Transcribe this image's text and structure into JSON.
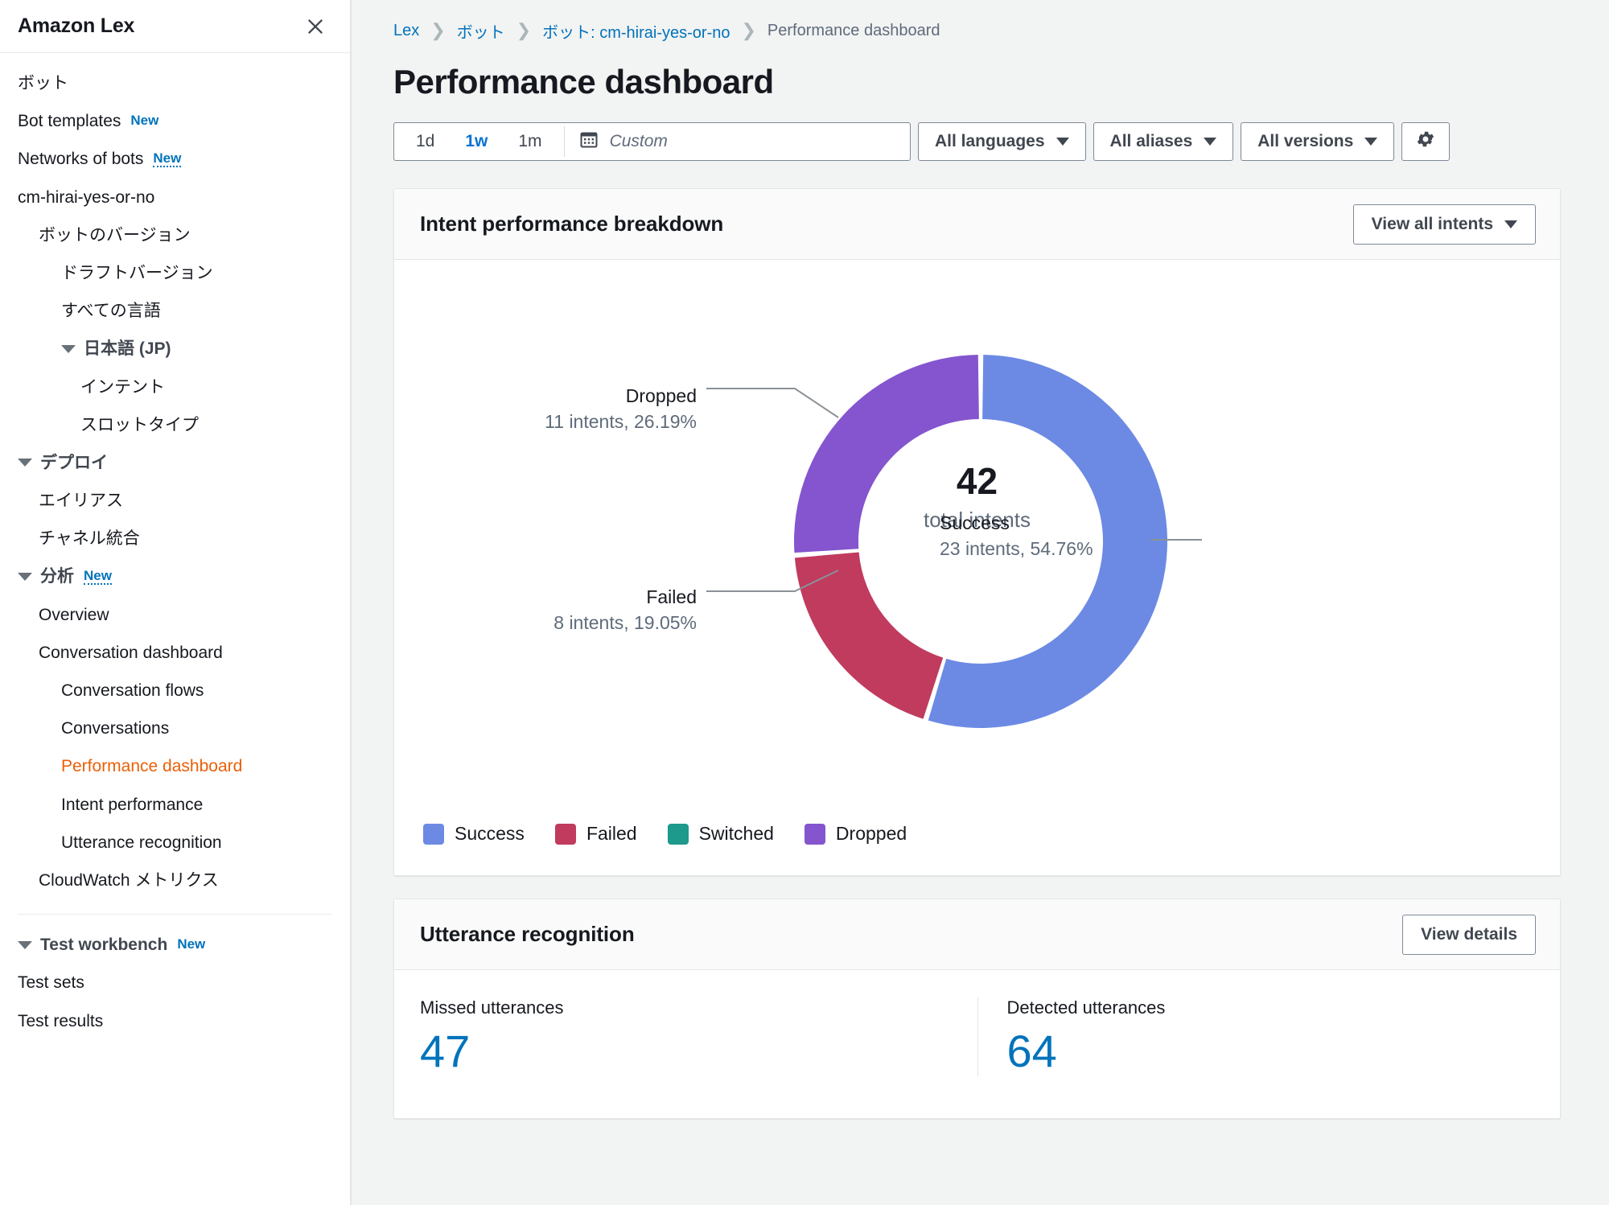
{
  "sidebar": {
    "title": "Amazon Lex",
    "close_icon": "close-icon",
    "items": [
      {
        "label": "ボット",
        "indent": 0,
        "type": "link"
      },
      {
        "label": "Bot templates",
        "indent": 0,
        "type": "link",
        "badge": "New",
        "badge_dotted": false
      },
      {
        "label": "Networks of bots",
        "indent": 0,
        "type": "link",
        "badge": "New",
        "badge_dotted": true
      },
      {
        "label": "cm-hirai-yes-or-no",
        "indent": 0,
        "type": "link"
      },
      {
        "label": "ボットのバージョン",
        "indent": 1,
        "type": "link"
      },
      {
        "label": "ドラフトバージョン",
        "indent": 2,
        "type": "link"
      },
      {
        "label": "すべての言語",
        "indent": 2,
        "type": "link"
      },
      {
        "label": "日本語 (JP)",
        "indent": 2,
        "type": "section",
        "caret": true
      },
      {
        "label": "インテント",
        "indent": 3,
        "type": "link"
      },
      {
        "label": "スロットタイプ",
        "indent": 3,
        "type": "link"
      },
      {
        "label": "デプロイ",
        "indent": 0,
        "type": "section",
        "caret": true
      },
      {
        "label": "エイリアス",
        "indent": 1,
        "type": "link"
      },
      {
        "label": "チャネル統合",
        "indent": 1,
        "type": "link"
      },
      {
        "label": "分析",
        "indent": 0,
        "type": "section",
        "caret": true,
        "badge": "New",
        "badge_dotted": true
      },
      {
        "label": "Overview",
        "indent": 1,
        "type": "link"
      },
      {
        "label": "Conversation dashboard",
        "indent": 1,
        "type": "link"
      },
      {
        "label": "Conversation flows",
        "indent": 2,
        "type": "link"
      },
      {
        "label": "Conversations",
        "indent": 2,
        "type": "link"
      },
      {
        "label": "Performance dashboard",
        "indent": 2,
        "type": "link",
        "active": true
      },
      {
        "label": "Intent performance",
        "indent": 2,
        "type": "link"
      },
      {
        "label": "Utterance recognition",
        "indent": 2,
        "type": "link"
      },
      {
        "label": "CloudWatch メトリクス",
        "indent": 1,
        "type": "link"
      },
      {
        "label": "Test workbench",
        "indent": 0,
        "type": "section",
        "caret": true,
        "badge": "New",
        "badge_dotted": false,
        "divider_before": true
      },
      {
        "label": "Test sets",
        "indent": 0,
        "type": "link"
      },
      {
        "label": "Test results",
        "indent": 0,
        "type": "link"
      }
    ]
  },
  "breadcrumb": {
    "items": [
      "Lex",
      "ボット",
      "ボット: cm-hirai-yes-or-no",
      "Performance dashboard"
    ],
    "separator": "❯"
  },
  "page": {
    "title": "Performance dashboard"
  },
  "toolbar": {
    "ranges": [
      {
        "label": "1d",
        "selected": false
      },
      {
        "label": "1w",
        "selected": true
      },
      {
        "label": "1m",
        "selected": false
      }
    ],
    "custom_placeholder": "Custom",
    "calendar_icon": "calendar-icon",
    "languages_label": "All languages",
    "aliases_label": "All aliases",
    "versions_label": "All versions",
    "settings_icon": "gear-icon"
  },
  "intent_card": {
    "title": "Intent performance breakdown",
    "view_all_label": "View all intents"
  },
  "chart_data": {
    "type": "pie",
    "title": "Intent performance breakdown",
    "center_value": "42",
    "center_label": "total intents",
    "total_intents": 42,
    "categories": [
      "Success",
      "Failed",
      "Switched",
      "Dropped"
    ],
    "values": [
      23,
      8,
      0,
      11
    ],
    "percents": [
      54.76,
      19.05,
      0,
      26.19
    ],
    "colors": [
      "#6C8AE4",
      "#C03B5E",
      "#1D9A8B",
      "#8455CE"
    ],
    "legend": [
      "Success",
      "Failed",
      "Switched",
      "Dropped"
    ],
    "legend_position": "bottom-left",
    "callouts": [
      {
        "name": "Success",
        "detail": "23 intents, 54.76%"
      },
      {
        "name": "Failed",
        "detail": "8 intents, 19.05%"
      },
      {
        "name": "Dropped",
        "detail": "11 intents, 26.19%"
      }
    ]
  },
  "utterance_card": {
    "title": "Utterance recognition",
    "view_details_label": "View details",
    "metrics": [
      {
        "label": "Missed utterances",
        "value": "47"
      },
      {
        "label": "Detected utterances",
        "value": "64"
      }
    ]
  }
}
